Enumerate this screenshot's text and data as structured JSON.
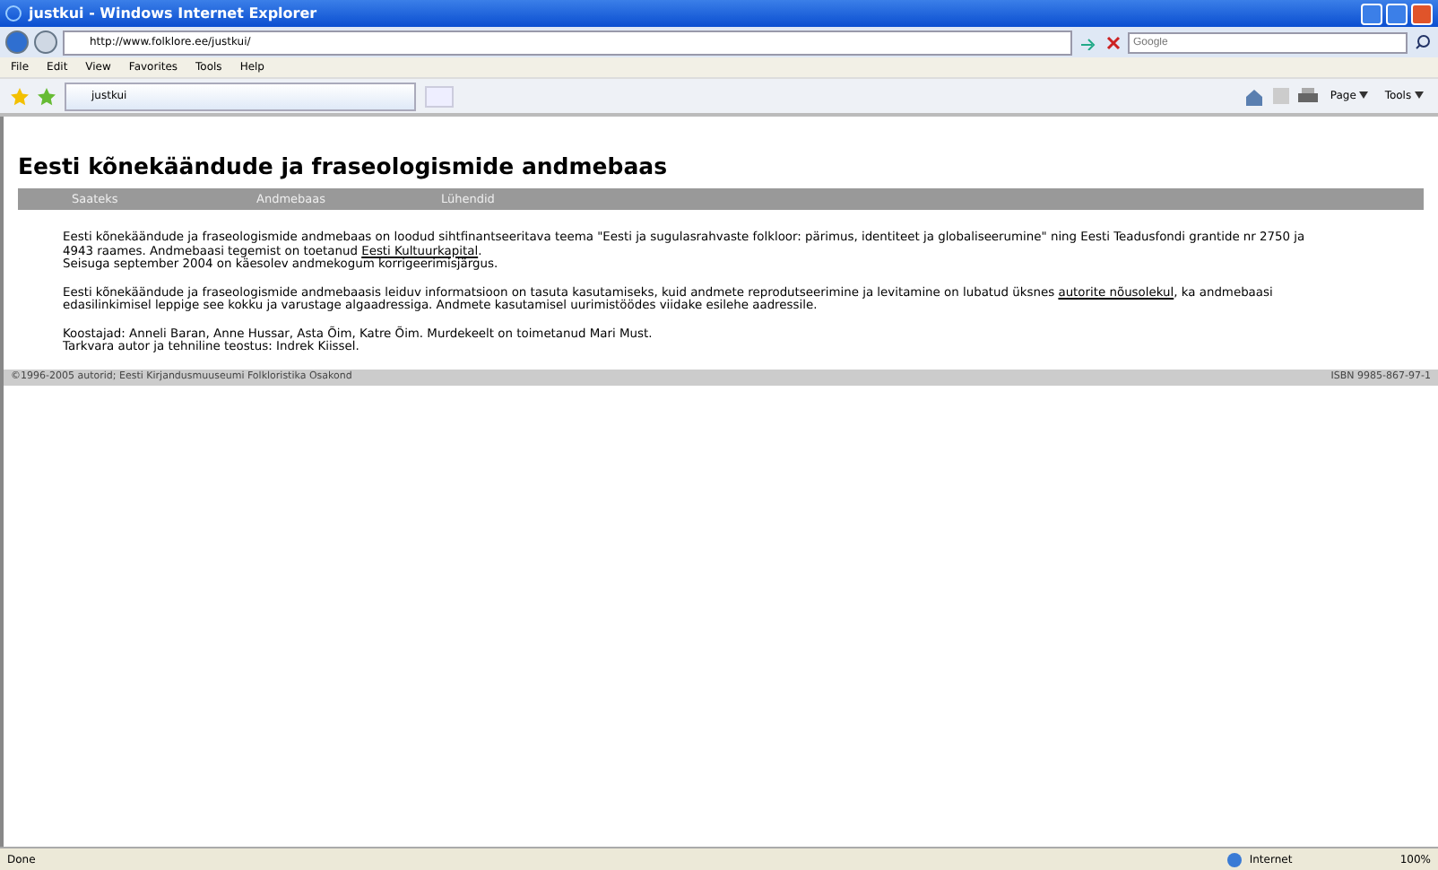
{
  "window": {
    "title": "justkui - Windows Internet Explorer"
  },
  "address_bar": {
    "url": "http://www.folklore.ee/justkui/",
    "search_placeholder": "Google"
  },
  "menu": [
    "File",
    "Edit",
    "View",
    "Favorites",
    "Tools",
    "Help"
  ],
  "tab": {
    "label": "justkui"
  },
  "command_bar": [
    {
      "label": "Page"
    },
    {
      "label": "Tools"
    }
  ],
  "page": {
    "heading": "Eesti kõnekäändude ja fraseologismide andmebaas",
    "nav": [
      "Saateks",
      "Andmebaas",
      "Lühendid"
    ],
    "paragraphs": [
      [
        {
          "text": "Eesti kõnekäändude ja fraseologismide andmebaas on loodud sihtfinantseeritava teema \"Eesti ja sugulasrahvaste folkloor: pärimus, identiteet ja globaliseerumine\" ning Eesti Teadusfondi grantide nr 2750 ja 4943 raames. Andmebaasi tegemist on toetanud ",
          "link": false
        },
        {
          "text": "Eesti Kultuurkapital",
          "link": true
        },
        {
          "text": ".",
          "link": false
        }
      ],
      [
        {
          "text": "Seisuga september 2004 on käesolev andmekogum korrigeerimisjärgus.",
          "link": false
        }
      ],
      [
        {
          "text": "Eesti kõnekäändude ja fraseologismide andmebaasis leiduv informatsioon on tasuta kasutamiseks, kuid andmete reprodutseerimine ja levitamine on lubatud üksnes ",
          "link": false
        },
        {
          "text": "autorite nõusolekul",
          "link": true
        },
        {
          "text": ", ka andmebaasi edasilinkimisel leppige see kokku ja varustage algaadressiga. Andmete kasutamisel uurimistöödes viidake esilehe aadressile.",
          "link": false
        }
      ],
      [
        {
          "text": "Koostajad: Anneli Baran, Anne Hussar, Asta Õim, Katre Õim. Murdekeelt on toimetanud Mari Must.",
          "link": false
        }
      ],
      [
        {
          "text": "Tarkvara autor ja tehniline teostus: Indrek Kiissel.",
          "link": false
        }
      ]
    ],
    "footer_left": "©1996-2005 autorid; Eesti Kirjandusmuuseumi Folkloristika Osakond",
    "footer_right": "ISBN 9985-867-97-1"
  },
  "status_bar": {
    "text": "Done",
    "zone": "Internet",
    "zoom": "100%"
  }
}
